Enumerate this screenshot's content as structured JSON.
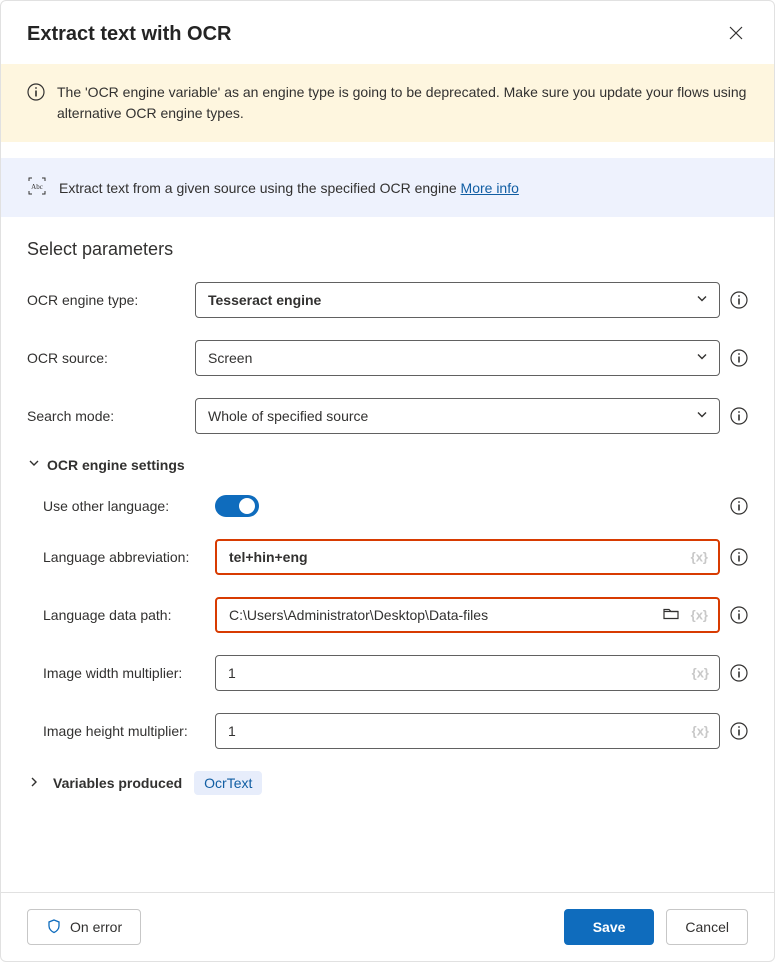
{
  "title": "Extract text with OCR",
  "warning": "The 'OCR engine variable' as an engine type is going to be deprecated.  Make sure you update your flows using alternative OCR engine types.",
  "info_banner": {
    "text": "Extract text from a given source using the specified OCR engine ",
    "link": "More info"
  },
  "section_title": "Select parameters",
  "fields": {
    "ocr_engine_type": {
      "label": "OCR engine type:",
      "value": "Tesseract engine"
    },
    "ocr_source": {
      "label": "OCR source:",
      "value": "Screen"
    },
    "search_mode": {
      "label": "Search mode:",
      "value": "Whole of specified source"
    }
  },
  "settings": {
    "header": "OCR engine settings",
    "use_other_language": {
      "label": "Use other language:"
    },
    "language_abbrev": {
      "label": "Language abbreviation:",
      "value": "tel+hin+eng"
    },
    "language_path": {
      "label": "Language data path:",
      "value": "C:\\Users\\Administrator\\Desktop\\Data-files"
    },
    "width_mult": {
      "label": "Image width multiplier:",
      "value": "1"
    },
    "height_mult": {
      "label": "Image height multiplier:",
      "value": "1"
    }
  },
  "variables": {
    "label": "Variables produced",
    "chip": "OcrText"
  },
  "footer": {
    "on_error": "On error",
    "save": "Save",
    "cancel": "Cancel"
  },
  "var_placeholder": "{x}"
}
